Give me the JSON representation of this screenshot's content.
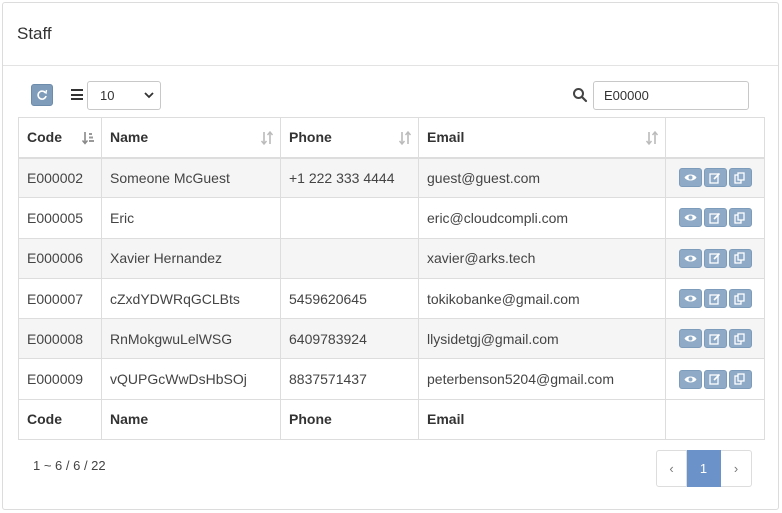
{
  "panel": {
    "title": "Staff"
  },
  "toolbar": {
    "refresh_icon": "refresh-icon",
    "page_size": "10",
    "search_value": "E00000"
  },
  "table": {
    "columns": [
      "Code",
      "Name",
      "Phone",
      "Email",
      ""
    ],
    "rows": [
      {
        "code": "E000002",
        "name": "Someone McGuest",
        "phone": "+1 222 333 4444",
        "email": "guest@guest.com"
      },
      {
        "code": "E000005",
        "name": "Eric",
        "phone": "",
        "email": "eric@cloudcompli.com"
      },
      {
        "code": "E000006",
        "name": "Xavier Hernandez",
        "phone": "",
        "email": "xavier@arks.tech"
      },
      {
        "code": "E000007",
        "name": "cZxdYDWRqGCLBts",
        "phone": "5459620645",
        "email": "tokikobanke@gmail.com"
      },
      {
        "code": "E000008",
        "name": "RnMokgwuLelWSG",
        "phone": "6409783924",
        "email": "llysidetgj@gmail.com"
      },
      {
        "code": "E000009",
        "name": "vQUPGcWwDsHbSOj",
        "phone": "8837571437",
        "email": "peterbenson5204@gmail.com"
      }
    ],
    "footer": [
      "Code",
      "Name",
      "Phone",
      "Email",
      ""
    ]
  },
  "summary": "1 ~ 6 / 6 / 22",
  "pager": {
    "prev": "‹",
    "current": "1",
    "next": "›"
  },
  "colors": {
    "accent": "#6b93c9",
    "action_button": "#8eaac6"
  }
}
